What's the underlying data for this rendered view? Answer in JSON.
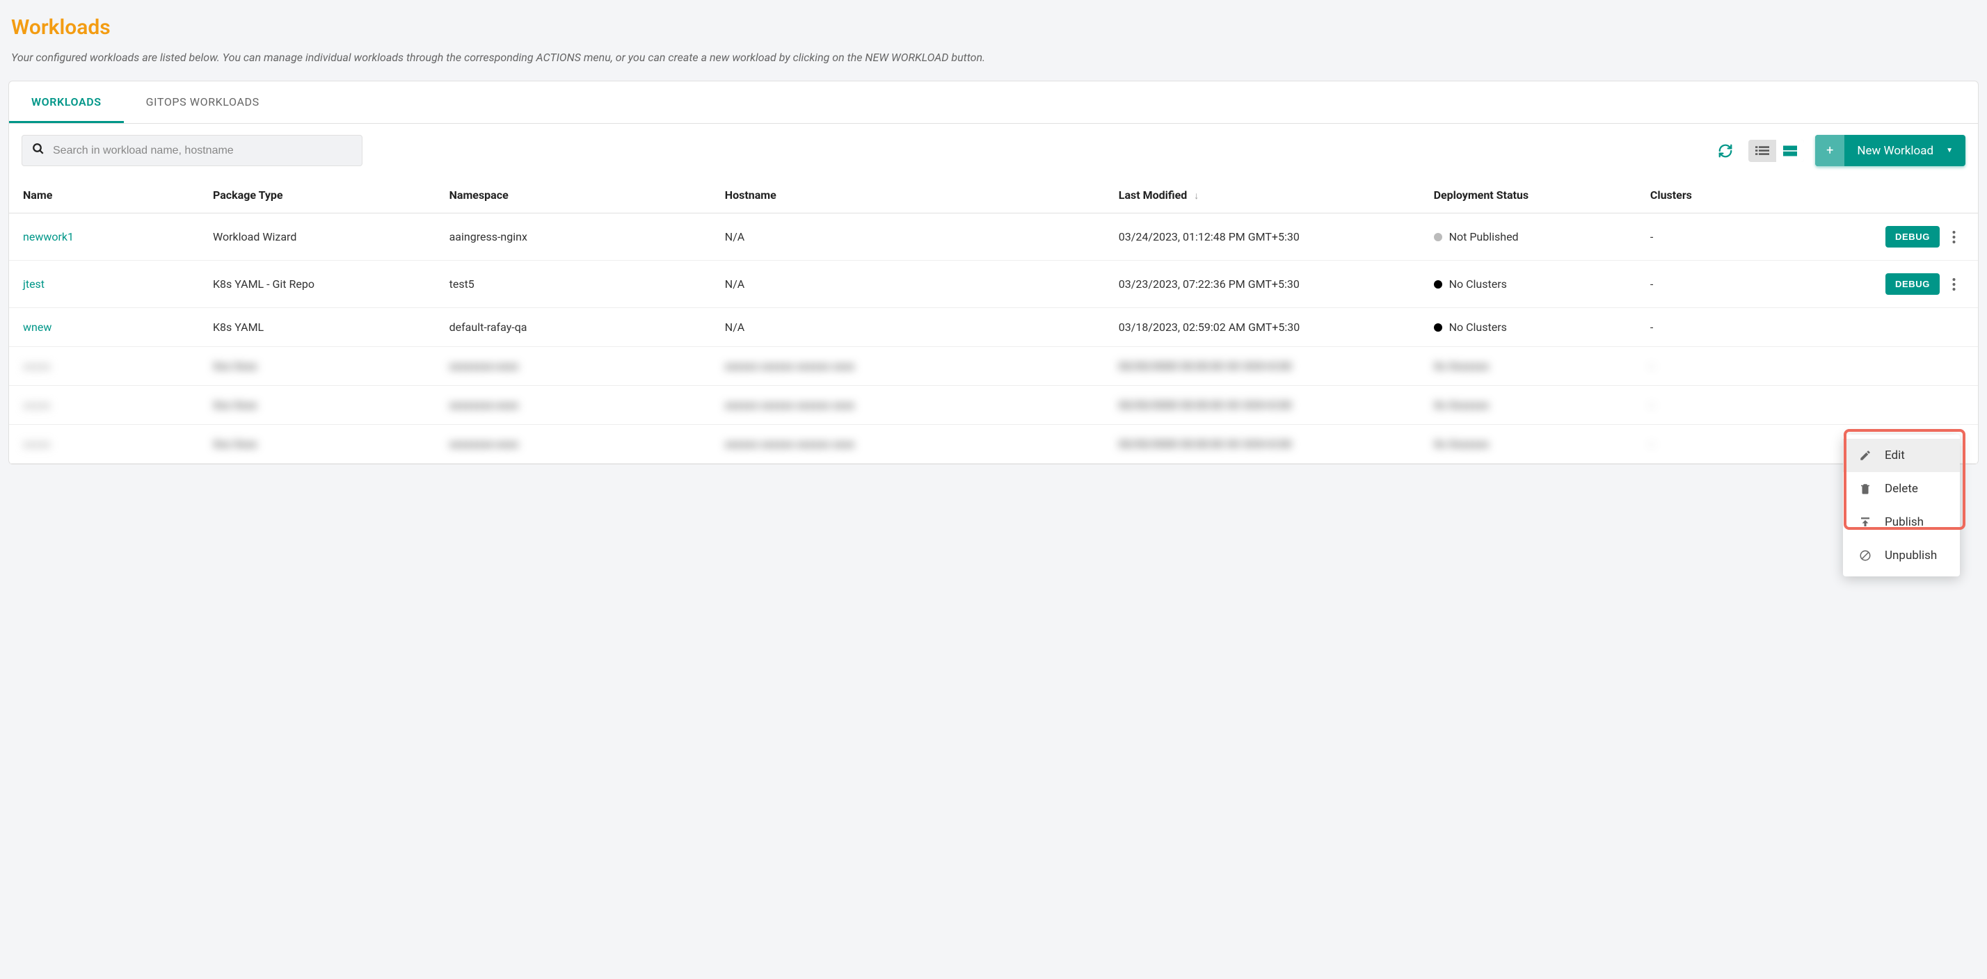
{
  "page": {
    "title": "Workloads",
    "description": "Your configured workloads are listed below. You can manage individual workloads through the corresponding ACTIONS menu, or you can create a new workload by clicking on the NEW WORKLOAD button."
  },
  "tabs": [
    {
      "label": "WORKLOADS",
      "active": true
    },
    {
      "label": "GITOPS WORKLOADS",
      "active": false
    }
  ],
  "search": {
    "placeholder": "Search in workload name, hostname"
  },
  "toolbar": {
    "new_label": "New Workload"
  },
  "columns": {
    "name": "Name",
    "package_type": "Package Type",
    "namespace": "Namespace",
    "hostname": "Hostname",
    "last_modified": "Last Modified",
    "deployment_status": "Deployment Status",
    "clusters": "Clusters"
  },
  "rows": [
    {
      "name": "newwork1",
      "package_type": "Workload Wizard",
      "namespace": "aaingress-nginx",
      "hostname": "N/A",
      "last_modified": "03/24/2023, 01:12:48 PM GMT+5:30",
      "status_dot": "gray",
      "status": "Not Published",
      "clusters": "-",
      "debug": "DEBUG"
    },
    {
      "name": "jtest",
      "package_type": "K8s YAML - Git Repo",
      "namespace": "test5",
      "hostname": "N/A",
      "last_modified": "03/23/2023, 07:22:36 PM GMT+5:30",
      "status_dot": "black",
      "status": "No Clusters",
      "clusters": "-",
      "debug": "DEBUG"
    },
    {
      "name": "wnew",
      "package_type": "K8s YAML",
      "namespace": "default-rafay-qa",
      "hostname": "N/A",
      "last_modified": "03/18/2023, 02:59:02 AM GMT+5:30",
      "status_dot": "black",
      "status": "No Clusters",
      "clusters": "-",
      "debug": ""
    }
  ],
  "blurred_rows": 3,
  "ctx_menu": {
    "items": [
      {
        "icon": "pencil",
        "label": "Edit",
        "hover": true
      },
      {
        "icon": "trash",
        "label": "Delete",
        "hover": false
      },
      {
        "icon": "publish",
        "label": "Publish",
        "hover": false
      },
      {
        "icon": "unpublish",
        "label": "Unpublish",
        "hover": false
      }
    ]
  }
}
